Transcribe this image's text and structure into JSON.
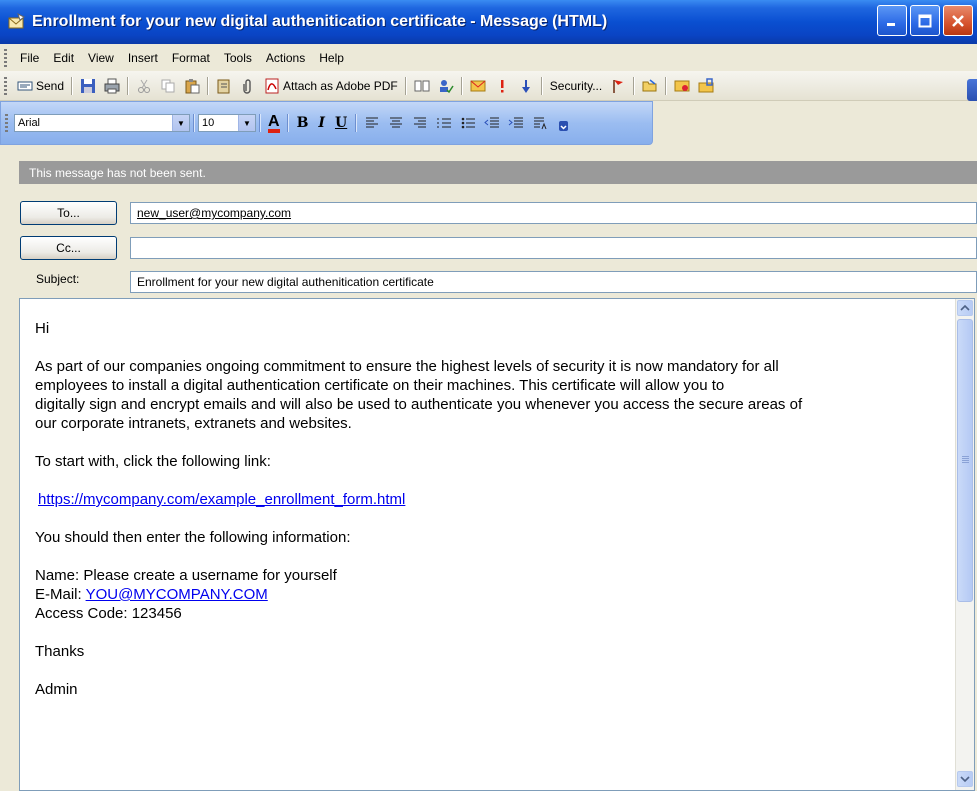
{
  "window": {
    "title": "Enrollment for your new digital authenitication certificate - Message (HTML)"
  },
  "menu": [
    {
      "label": "File",
      "access": "F"
    },
    {
      "label": "Edit",
      "access": "E"
    },
    {
      "label": "View",
      "access": "V"
    },
    {
      "label": "Insert",
      "access": "I"
    },
    {
      "label": "Format",
      "access": "o"
    },
    {
      "label": "Tools",
      "access": "T"
    },
    {
      "label": "Actions",
      "access": "A"
    },
    {
      "label": "Help",
      "access": "H"
    }
  ],
  "toolbar": {
    "send_label": "Send",
    "attach_pdf_label": "Attach as Adobe PDF",
    "security_label": "Security..."
  },
  "format": {
    "font": "Arial",
    "size": "10",
    "bold": "B",
    "italic": "I",
    "underline": "U",
    "font_color": "A"
  },
  "info_bar": "This message has not been sent.",
  "address": {
    "to_button": "To...",
    "cc_button": "Cc...",
    "subject_label": "Subject:",
    "to_value": "new_user@mycompany.com",
    "cc_value": "",
    "subject_value": "Enrollment for your new digital authenitication certificate"
  },
  "body": {
    "greeting": "Hi",
    "para1": [
      "As part of our companies ongoing commitment to ensure the highest levels of security it is now mandatory for all",
      "employees to install a digital authentication certificate on their machines. This certificate will allow you to",
      "digitally sign and encrypt emails and will also be used to authenticate you whenever you access the secure areas of",
      "our corporate intranets, extranets and websites."
    ],
    "para2": "To start with, click the following link:",
    "link": "https://mycompany.com/example_enrollment_form.html",
    "para3": "You should then enter the following information:",
    "name_line": "Name: Please create a username for yourself",
    "email_prefix": "E-Mail: ",
    "email_value": "YOU@MYCOMPANY.COM",
    "code_line": "Access Code: 123456",
    "thanks": "Thanks",
    "signature": "Admin"
  },
  "colors": {
    "titlebar": "#0a4fd1",
    "link": "#0000ee",
    "info_bar": "#9a9a9a"
  }
}
